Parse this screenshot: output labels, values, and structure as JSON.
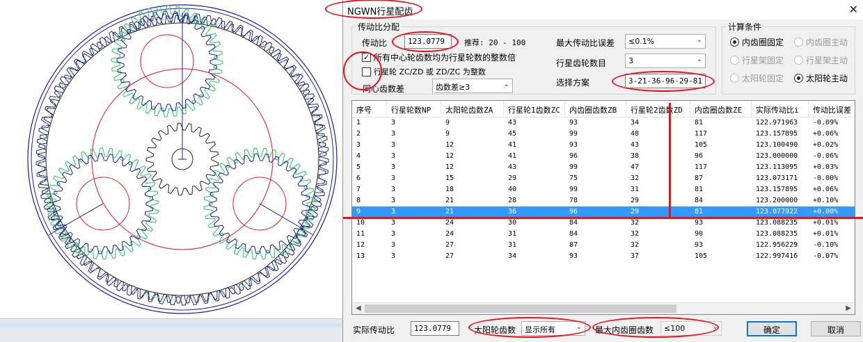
{
  "window": {
    "title": "NGWN行星配齿",
    "close_glyph": "✕"
  },
  "ratio_group": {
    "title": "传动比分配",
    "ratio_label": "传动比",
    "ratio_value": "123.0779",
    "recommend_text": "推荐: 20 - 100",
    "check_integer_label": "所有中心轮齿数均为行星轮数的整数倍",
    "check_integer_checked": true,
    "check_zc_label": "行星轮 ZC/ZD 或 ZD/ZC 为整数",
    "check_zc_checked": false,
    "concentric_label": "同心齿数差",
    "concentric_value": "齿数差≥3",
    "max_error_label": "最大传动比误差",
    "max_error_value": "≤0.1%",
    "planet_count_label": "行星齿轮数目",
    "planet_count_value": "3",
    "scheme_label": "选择方案",
    "scheme_value": "3-21-36-96-29-81"
  },
  "calc_group": {
    "title": "计算条件",
    "radios": [
      {
        "label": "内齿圈固定",
        "on": true,
        "disabled": false
      },
      {
        "label": "内齿圈主动",
        "on": false,
        "disabled": true
      },
      {
        "label": "行星架固定",
        "on": false,
        "disabled": true
      },
      {
        "label": "行星架主动",
        "on": false,
        "disabled": true
      },
      {
        "label": "太阳轮固定",
        "on": false,
        "disabled": true
      },
      {
        "label": "太阳轮主动",
        "on": true,
        "disabled": false
      }
    ]
  },
  "table": {
    "columns": [
      "序号",
      "行星轮数NP",
      "太阳轮齿数ZA",
      "行星轮1齿数ZC",
      "内齿圈齿数ZB",
      "行星轮2齿数ZD",
      "内齿圈齿数ZE",
      "实际传动比i",
      "传动比误差"
    ],
    "selected_index": 8,
    "rows": [
      [
        "1",
        "3",
        "9",
        "43",
        "93",
        "34",
        "81",
        "122.971963",
        "-0.09%"
      ],
      [
        "2",
        "3",
        "9",
        "45",
        "99",
        "48",
        "117",
        "123.157895",
        "+0.06%"
      ],
      [
        "3",
        "3",
        "12",
        "41",
        "93",
        "43",
        "105",
        "123.100490",
        "+0.02%"
      ],
      [
        "4",
        "3",
        "12",
        "41",
        "96",
        "38",
        "96",
        "123.000000",
        "-0.06%"
      ],
      [
        "5",
        "3",
        "12",
        "43",
        "99",
        "47",
        "117",
        "123.113095",
        "+0.03%"
      ],
      [
        "6",
        "3",
        "15",
        "29",
        "75",
        "32",
        "87",
        "123.073171",
        "-0.00%"
      ],
      [
        "7",
        "3",
        "18",
        "40",
        "99",
        "31",
        "81",
        "123.157895",
        "+0.06%"
      ],
      [
        "8",
        "3",
        "21",
        "28",
        "78",
        "29",
        "84",
        "123.200000",
        "+0.10%"
      ],
      [
        "9",
        "3",
        "21",
        "36",
        "96",
        "29",
        "81",
        "123.077922",
        "+0.00%"
      ],
      [
        "10",
        "3",
        "24",
        "30",
        "84",
        "32",
        "93",
        "123.088235",
        "+0.01%"
      ],
      [
        "11",
        "3",
        "24",
        "31",
        "84",
        "32",
        "90",
        "123.088235",
        "+0.01%"
      ],
      [
        "12",
        "3",
        "27",
        "31",
        "87",
        "32",
        "93",
        "122.956229",
        "-0.10%"
      ],
      [
        "13",
        "3",
        "27",
        "34",
        "93",
        "37",
        "105",
        "122.997416",
        "-0.07%"
      ]
    ]
  },
  "footer": {
    "actual_ratio_label": "实际传动比",
    "actual_ratio_value": "123.0779",
    "sun_teeth_label": "太阳轮齿数",
    "sun_teeth_value": "显示所有",
    "max_ring_label": "最大内齿圈齿数",
    "max_ring_value": "≤100",
    "ok_label": "确定",
    "cancel_label": "取消"
  },
  "colors": {
    "accent_red": "#e8101a",
    "selection": "#3399ff",
    "gear_green": "#22c55e",
    "gear_blue": "#1a1aa8"
  }
}
